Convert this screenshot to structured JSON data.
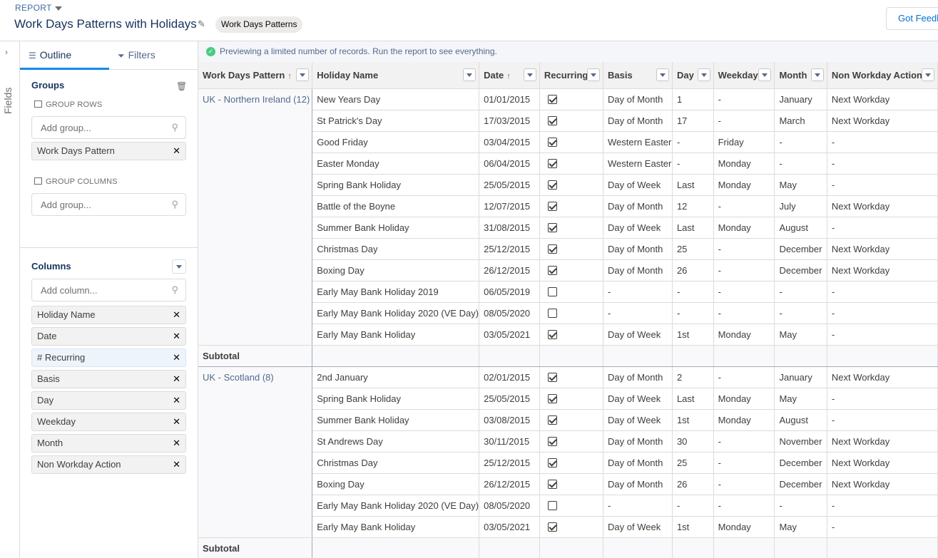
{
  "header": {
    "report_label": "REPORT",
    "title": "Work Days Patterns with Holidays",
    "report_type_pill": "Work Days Patterns",
    "feedback_button": "Got Feedback?"
  },
  "rail": {
    "label": "Fields"
  },
  "sidepanel": {
    "tabs": {
      "outline": "Outline",
      "filters": "Filters"
    },
    "groups_title": "Groups",
    "group_rows_title": "GROUP ROWS",
    "group_rows_placeholder": "Add group...",
    "group_rows_items": [
      "Work Days Pattern"
    ],
    "group_columns_title": "GROUP COLUMNS",
    "group_columns_placeholder": "Add group...",
    "columns_title": "Columns",
    "columns_placeholder": "Add column...",
    "columns_items": [
      "Holiday Name",
      "Date",
      "# Recurring",
      "Basis",
      "Day",
      "Weekday",
      "Month",
      "Non Workday Action"
    ]
  },
  "notice": "Previewing a limited number of records. Run the report to see everything.",
  "table": {
    "headers": [
      "Work Days Pattern",
      "Holiday Name",
      "Date",
      "Recurring",
      "Basis",
      "Day",
      "Weekday",
      "Month",
      "Non Workday Action"
    ],
    "subtotal_label": "Subtotal",
    "groups": [
      {
        "label": "UK - Northern Ireland (12)",
        "rows": [
          {
            "name": "New Years Day",
            "date": "01/01/2015",
            "recurring": true,
            "basis": "Day of Month",
            "day": "1",
            "weekday": "-",
            "month": "January",
            "action": "Next Workday"
          },
          {
            "name": "St Patrick's Day",
            "date": "17/03/2015",
            "recurring": true,
            "basis": "Day of Month",
            "day": "17",
            "weekday": "-",
            "month": "March",
            "action": "Next Workday"
          },
          {
            "name": "Good Friday",
            "date": "03/04/2015",
            "recurring": true,
            "basis": "Western Easter",
            "day": "-",
            "weekday": "Friday",
            "month": "-",
            "action": "-"
          },
          {
            "name": "Easter Monday",
            "date": "06/04/2015",
            "recurring": true,
            "basis": "Western Easter",
            "day": "-",
            "weekday": "Monday",
            "month": "-",
            "action": "-"
          },
          {
            "name": "Spring Bank Holiday",
            "date": "25/05/2015",
            "recurring": true,
            "basis": "Day of Week",
            "day": "Last",
            "weekday": "Monday",
            "month": "May",
            "action": "-"
          },
          {
            "name": "Battle of the Boyne",
            "date": "12/07/2015",
            "recurring": true,
            "basis": "Day of Month",
            "day": "12",
            "weekday": "-",
            "month": "July",
            "action": "Next Workday"
          },
          {
            "name": "Summer Bank Holiday",
            "date": "31/08/2015",
            "recurring": true,
            "basis": "Day of Week",
            "day": "Last",
            "weekday": "Monday",
            "month": "August",
            "action": "-"
          },
          {
            "name": "Christmas Day",
            "date": "25/12/2015",
            "recurring": true,
            "basis": "Day of Month",
            "day": "25",
            "weekday": "-",
            "month": "December",
            "action": "Next Workday"
          },
          {
            "name": "Boxing Day",
            "date": "26/12/2015",
            "recurring": true,
            "basis": "Day of Month",
            "day": "26",
            "weekday": "-",
            "month": "December",
            "action": "Next Workday"
          },
          {
            "name": "Early May Bank Holiday 2019",
            "date": "06/05/2019",
            "recurring": false,
            "basis": "-",
            "day": "-",
            "weekday": "-",
            "month": "-",
            "action": "-"
          },
          {
            "name": "Early May Bank Holiday 2020 (VE Day)",
            "date": "08/05/2020",
            "recurring": false,
            "basis": "-",
            "day": "-",
            "weekday": "-",
            "month": "-",
            "action": "-"
          },
          {
            "name": "Early May Bank Holiday",
            "date": "03/05/2021",
            "recurring": true,
            "basis": "Day of Week",
            "day": "1st",
            "weekday": "Monday",
            "month": "May",
            "action": "-"
          }
        ]
      },
      {
        "label": "UK - Scotland (8)",
        "rows": [
          {
            "name": "2nd January",
            "date": "02/01/2015",
            "recurring": true,
            "basis": "Day of Month",
            "day": "2",
            "weekday": "-",
            "month": "January",
            "action": "Next Workday"
          },
          {
            "name": "Spring Bank Holiday",
            "date": "25/05/2015",
            "recurring": true,
            "basis": "Day of Week",
            "day": "Last",
            "weekday": "Monday",
            "month": "May",
            "action": "-"
          },
          {
            "name": "Summer Bank Holiday",
            "date": "03/08/2015",
            "recurring": true,
            "basis": "Day of Week",
            "day": "1st",
            "weekday": "Monday",
            "month": "August",
            "action": "-"
          },
          {
            "name": "St Andrews Day",
            "date": "30/11/2015",
            "recurring": true,
            "basis": "Day of Month",
            "day": "30",
            "weekday": "-",
            "month": "November",
            "action": "Next Workday"
          },
          {
            "name": "Christmas Day",
            "date": "25/12/2015",
            "recurring": true,
            "basis": "Day of Month",
            "day": "25",
            "weekday": "-",
            "month": "December",
            "action": "Next Workday"
          },
          {
            "name": "Boxing Day",
            "date": "26/12/2015",
            "recurring": true,
            "basis": "Day of Month",
            "day": "26",
            "weekday": "-",
            "month": "December",
            "action": "Next Workday"
          },
          {
            "name": "Early May Bank Holiday 2020 (VE Day)",
            "date": "08/05/2020",
            "recurring": false,
            "basis": "-",
            "day": "-",
            "weekday": "-",
            "month": "-",
            "action": "-"
          },
          {
            "name": "Early May Bank Holiday",
            "date": "03/05/2021",
            "recurring": true,
            "basis": "Day of Week",
            "day": "1st",
            "weekday": "Monday",
            "month": "May",
            "action": "-"
          }
        ]
      }
    ]
  }
}
